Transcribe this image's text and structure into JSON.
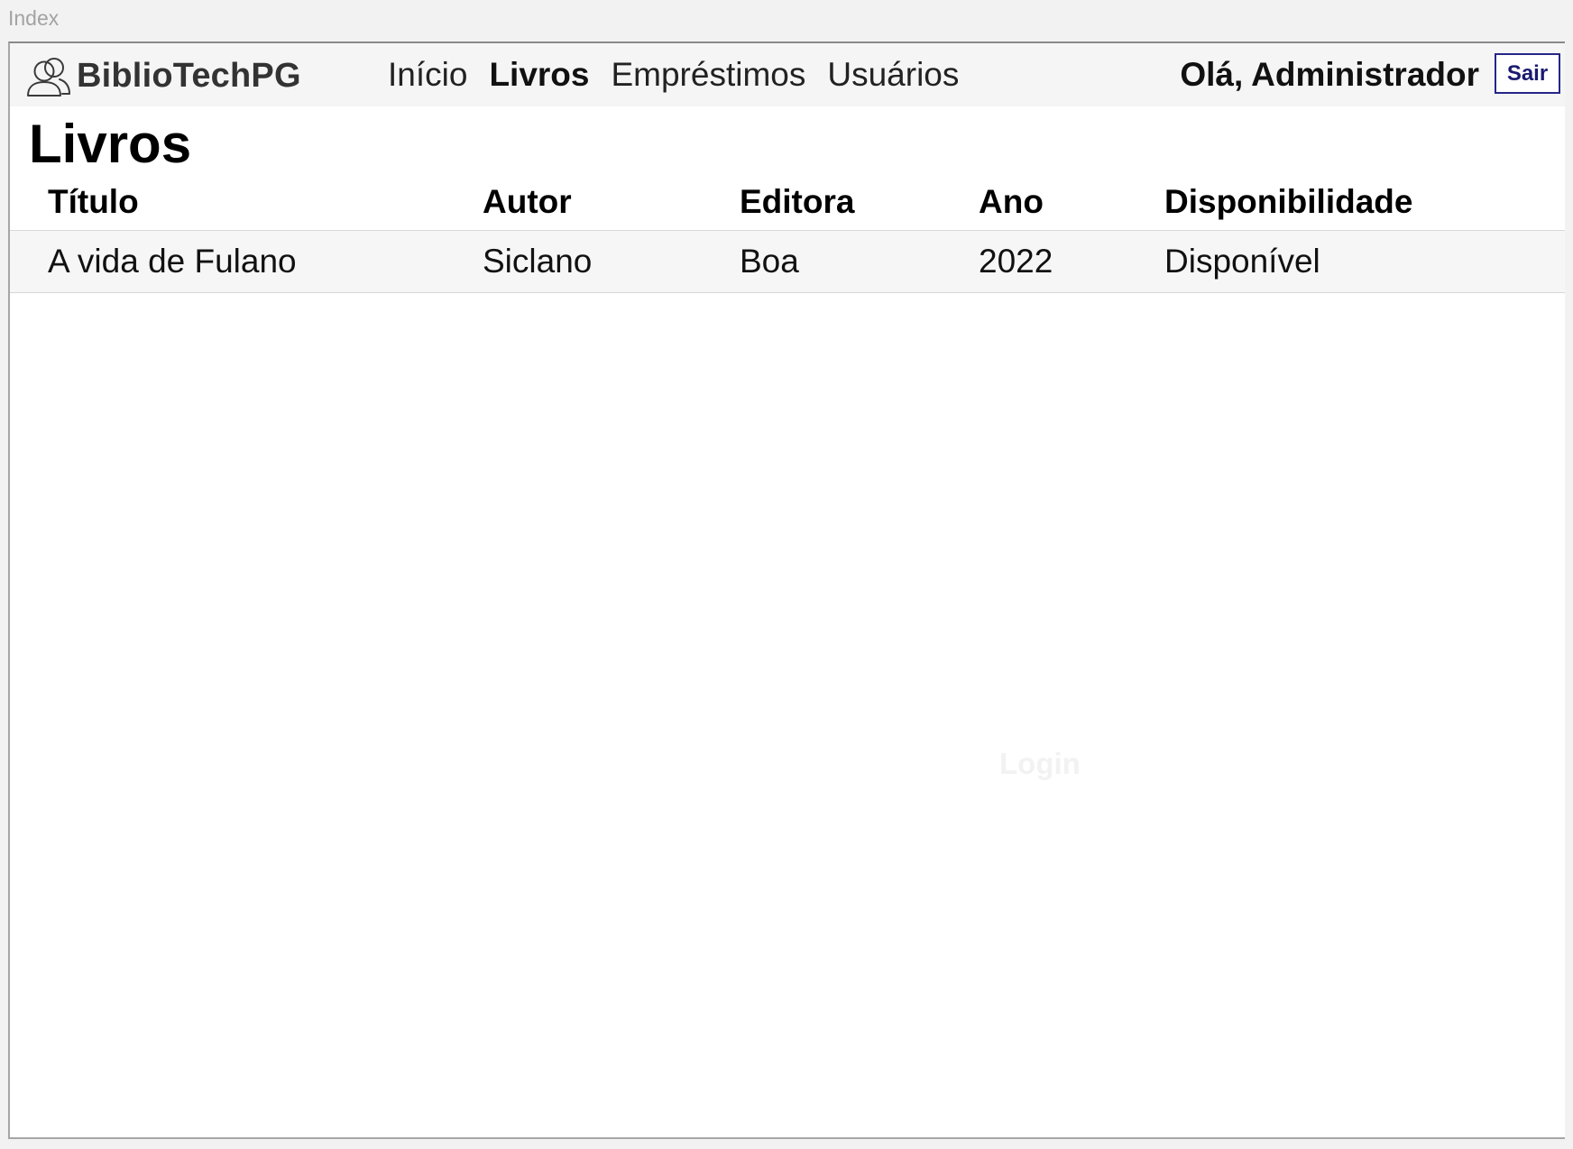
{
  "canvas": {
    "label": "Index"
  },
  "navbar": {
    "brand": "BiblioTechPG",
    "links": [
      {
        "label": "Início",
        "active": false
      },
      {
        "label": "Livros",
        "active": true
      },
      {
        "label": "Empréstimos",
        "active": false
      },
      {
        "label": "Usuários",
        "active": false
      }
    ],
    "greeting": "Olá, Administrador",
    "logout_label": "Sair"
  },
  "page": {
    "title": "Livros"
  },
  "table": {
    "headers": [
      "Título",
      "Autor",
      "Editora",
      "Ano",
      "Disponibilidade"
    ],
    "rows": [
      [
        "A vida de Fulano",
        "Siclano",
        "Boa",
        "2022",
        "Disponível"
      ]
    ]
  },
  "ghost_text": "Login",
  "colors": {
    "logout_border": "#26268a",
    "row_background": "#f6f6f6",
    "navbar_background": "#f5f5f5"
  },
  "icons": {
    "brand": "users-icon"
  }
}
